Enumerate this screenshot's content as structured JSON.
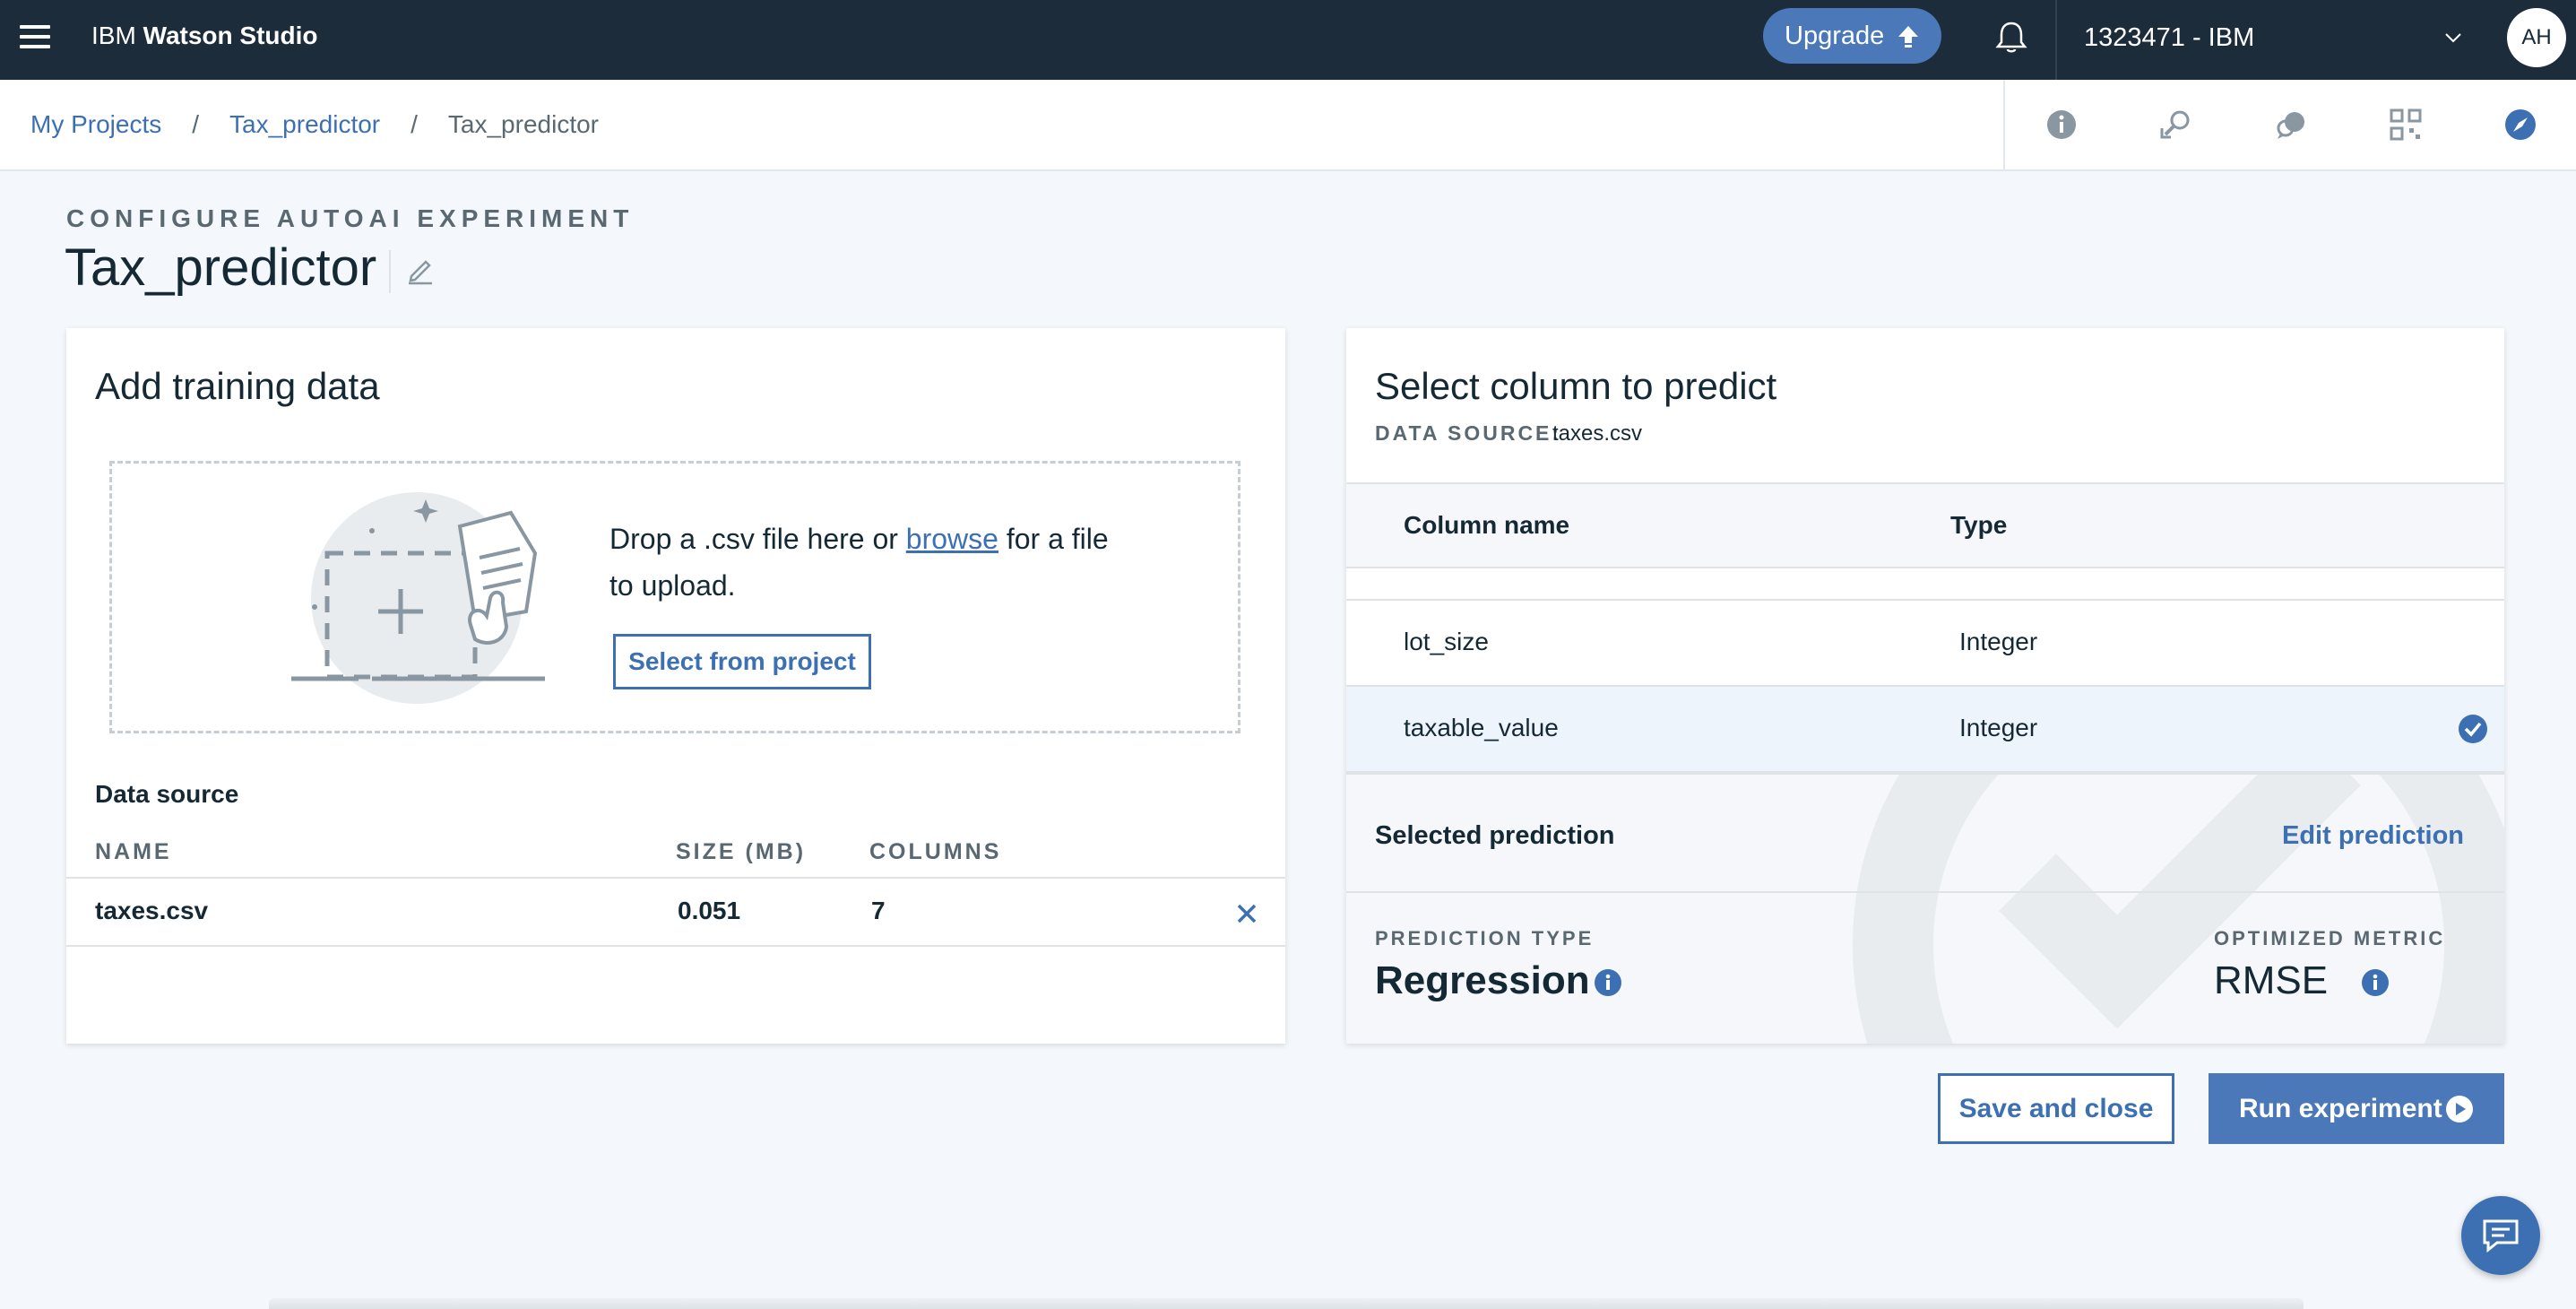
{
  "topbar": {
    "brand_prefix": "IBM",
    "brand_name": "Watson Studio",
    "upgrade_label": "Upgrade",
    "account_label": "1323471 - IBM",
    "avatar_initials": "AH"
  },
  "breadcrumb": {
    "items": [
      "My Projects",
      "Tax_predictor",
      "Tax_predictor"
    ],
    "separator": "/"
  },
  "header": {
    "eyebrow": "CONFIGURE AUTOAI EXPERIMENT",
    "title": "Tax_predictor"
  },
  "training": {
    "title": "Add training data",
    "drop_text_before": "Drop a .csv file here or ",
    "browse_link": "browse",
    "drop_text_after": " for a file to upload.",
    "select_button": "Select from project",
    "data_source_label": "Data source",
    "columns": [
      "NAME",
      "SIZE (MB)",
      "COLUMNS"
    ],
    "rows": [
      {
        "name": "taxes.csv",
        "size": "0.051",
        "columns": "7"
      }
    ]
  },
  "prediction": {
    "title": "Select column to predict",
    "data_source_label": "DATA SOURCE:",
    "data_source_value": "taxes.csv",
    "table_headers": [
      "Column name",
      "Type"
    ],
    "rows": [
      {
        "name": "lot_size",
        "type": "Integer",
        "selected": false
      },
      {
        "name": "taxable_value",
        "type": "Integer",
        "selected": true
      }
    ],
    "selected_label": "Selected prediction",
    "edit_label": "Edit prediction",
    "prediction_type_label": "PREDICTION TYPE",
    "prediction_type_value": "Regression",
    "metric_label": "OPTIMIZED METRIC",
    "metric_value": "RMSE"
  },
  "actions": {
    "save_close": "Save and close",
    "run": "Run experiment"
  },
  "colors": {
    "topbar_bg": "#1d2c3b",
    "accent": "#3d70b2",
    "primary_button": "#4a78b8",
    "page_bg": "#f4f7fb"
  }
}
